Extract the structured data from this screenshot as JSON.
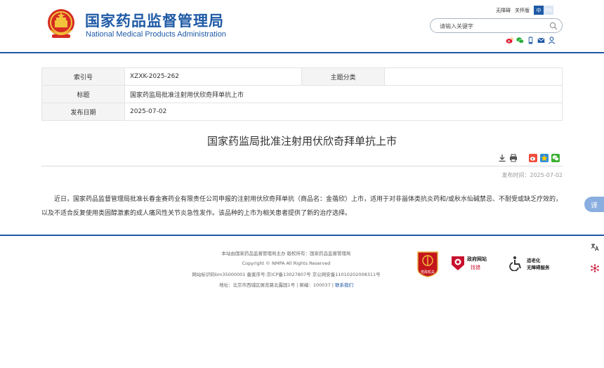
{
  "header": {
    "title_cn": "国家药品监督管理局",
    "title_en": "National Medical Products Administration",
    "links": [
      "无障碍",
      "关怀版"
    ],
    "lang_zh": "中",
    "lang_en": "EN",
    "search": {
      "placeholder": "请输入关键字",
      "value": ""
    },
    "icons": [
      "weibo-icon",
      "wechat-icon",
      "mobile-icon",
      "mail-icon",
      "user-icon"
    ]
  },
  "info": {
    "rows": [
      {
        "label": "索引号",
        "value": "XZXK-2025-262",
        "label2": "主题分类",
        "value2": ""
      },
      {
        "label": "标题",
        "value": "国家药监局批准注射用伏欣奇拜单抗上市"
      },
      {
        "label": "发布日期",
        "value": "2025-07-02"
      }
    ]
  },
  "article": {
    "title": "国家药监局批准注射用伏欣奇拜单抗上市",
    "pub_label": "发布时间：",
    "pub_date": "2025-07-02",
    "body": "近日，国家药品监督管理局批准长春金赛药业有限责任公司申报的注射用伏欣奇拜单抗（商品名：金蓓欣）上市，适用于对非甾体类抗炎药和/或秋水仙碱禁忌、不耐受或缺乏疗效的，以及不适合反复使用类固醇激素的成人痛风性关节炎急性发作。该品种的上市为相关患者提供了新的治疗选择。",
    "tool_icons": [
      "download-icon",
      "print-icon",
      "weibo-share-icon",
      "qzone-share-icon",
      "wechat-share-icon"
    ]
  },
  "footer": {
    "line1": "本站由国家药品监督管理局主办 版权所有：国家药品监督管理局",
    "line2": "Copyright © NMPA All Rights Reserved",
    "line3": "网站标识码bm35000001    备案序号:京ICP备13027807号    京公网安备11010202008311号",
    "line4": "地址：北京市西城区展览路北露园1号 | 邮编：100037 |",
    "contact": "联系我们",
    "party_badge_text": "党政机关",
    "jiucuo_title": "政府网站",
    "jiucuo_sub": "找错",
    "access_title": "适老化",
    "access_sub": "无障碍服务"
  },
  "float": {
    "translate": "译"
  },
  "colors": {
    "brand_blue": "#1f5aa6",
    "accent_red": "#c8102e"
  }
}
